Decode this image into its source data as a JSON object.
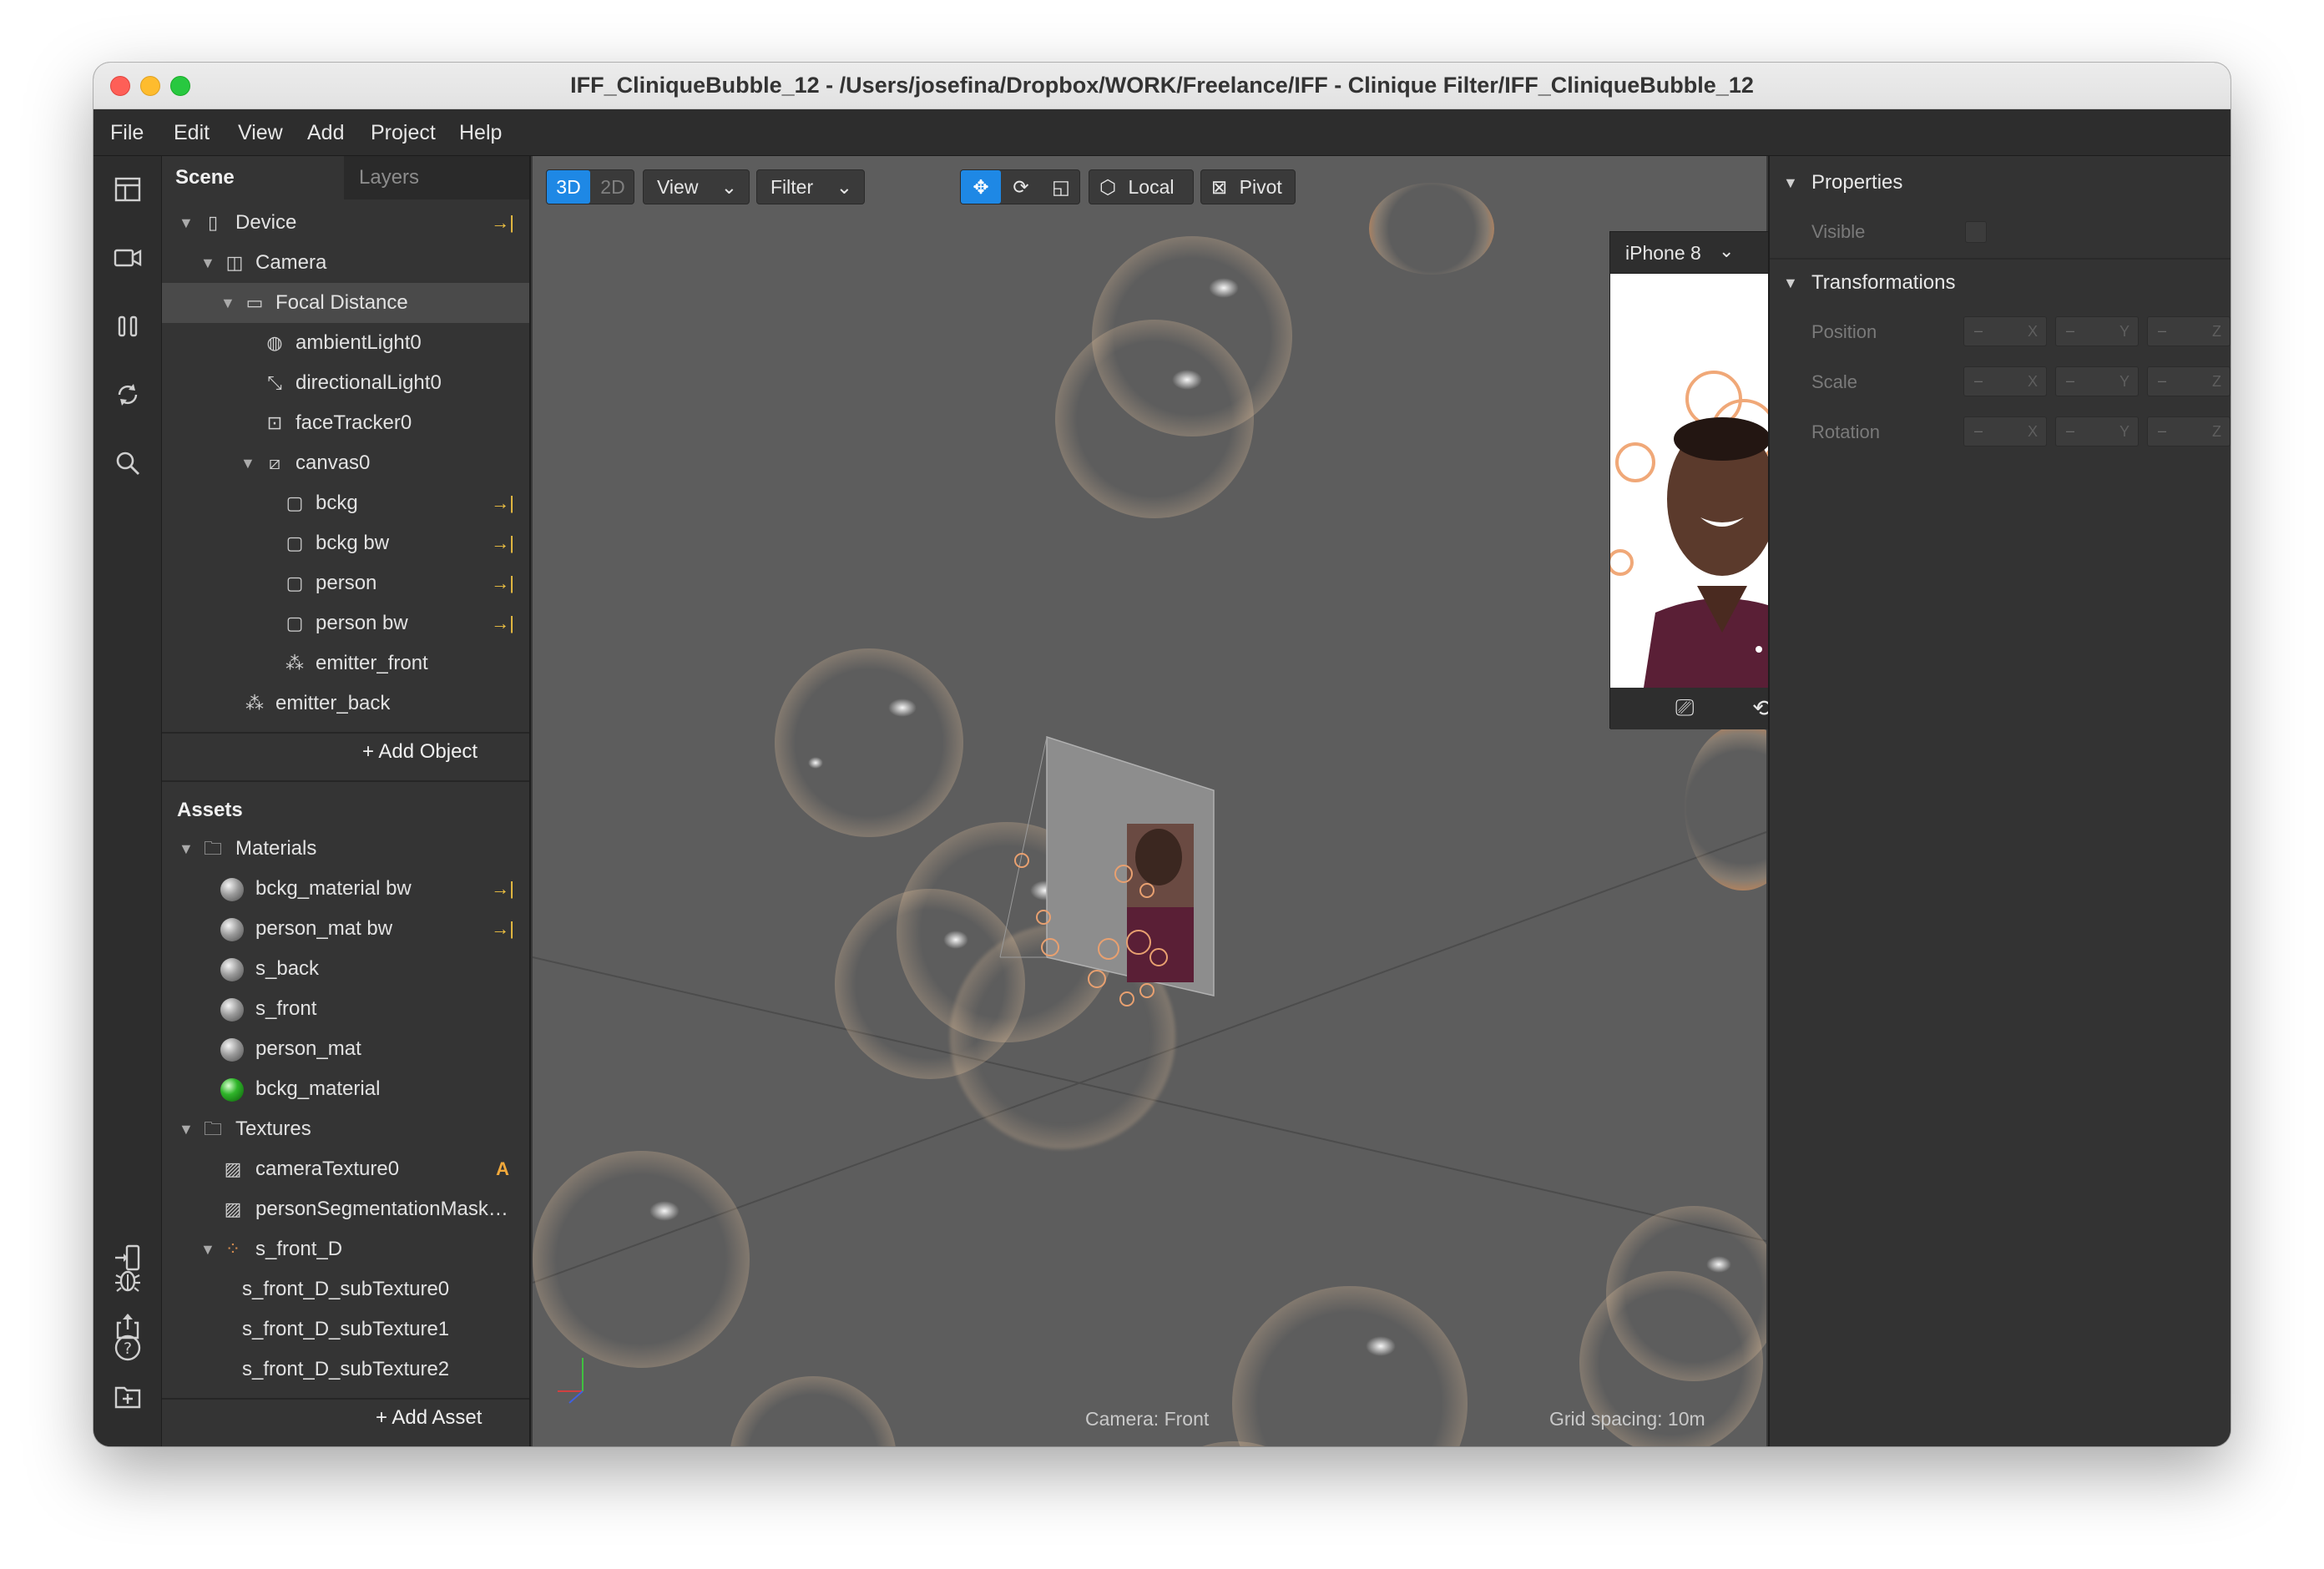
{
  "window": {
    "title": "IFF_CliniqueBubble_12 - /Users/josefina/Dropbox/WORK/Freelance/IFF - Clinique Filter/IFF_CliniqueBubble_12"
  },
  "menu": [
    "File",
    "Edit",
    "View",
    "Add",
    "Project",
    "Help"
  ],
  "scene_panel": {
    "tabs": [
      "Scene",
      "Layers"
    ],
    "tree": [
      {
        "label": "Device",
        "pin": "→|"
      },
      {
        "label": "Camera"
      },
      {
        "label": "Focal Distance"
      },
      {
        "label": "ambientLight0"
      },
      {
        "label": "directionalLight0"
      },
      {
        "label": "faceTracker0"
      },
      {
        "label": "canvas0"
      },
      {
        "label": "bckg",
        "pin": "→|"
      },
      {
        "label": "bckg bw",
        "pin": "→|"
      },
      {
        "label": "person",
        "pin": "→|"
      },
      {
        "label": "person bw",
        "pin": "→|"
      },
      {
        "label": "emitter_front"
      },
      {
        "label": "emitter_back"
      }
    ],
    "add_object": "Add Object"
  },
  "assets_panel": {
    "title": "Assets",
    "materials_folder": "Materials",
    "materials": [
      {
        "label": "bckg_material bw",
        "pin": "→|"
      },
      {
        "label": "person_mat bw",
        "pin": "→|"
      },
      {
        "label": "s_back"
      },
      {
        "label": "s_front"
      },
      {
        "label": "person_mat"
      },
      {
        "label": "bckg_material"
      }
    ],
    "textures_folder": "Textures",
    "textures": [
      {
        "label": "cameraTexture0",
        "badge": "A"
      },
      {
        "label": "personSegmentationMask…"
      },
      {
        "label": "s_front_D"
      },
      {
        "label": "s_front_D_subTexture0"
      },
      {
        "label": "s_front_D_subTexture1"
      },
      {
        "label": "s_front_D_subTexture2"
      }
    ],
    "add_asset": "Add Asset"
  },
  "viewport_toolbar": {
    "mode_3d": "3D",
    "mode_2d": "2D",
    "view": "View",
    "filter": "Filter",
    "local": "Local",
    "pivot": "Pivot"
  },
  "viewport": {
    "camera_label": "Camera: Front",
    "grid_spacing": "Grid spacing: 10m"
  },
  "simulator": {
    "device": "iPhone 8"
  },
  "inspector": {
    "properties_title": "Properties",
    "visible_label": "Visible",
    "transformations_title": "Transformations",
    "rows": [
      {
        "label": "Position",
        "values": [
          "–",
          "–",
          "–"
        ]
      },
      {
        "label": "Scale",
        "values": [
          "–",
          "–",
          "–"
        ]
      },
      {
        "label": "Rotation",
        "values": [
          "–",
          "–",
          "–"
        ]
      }
    ],
    "axes": [
      "X",
      "Y",
      "Z"
    ]
  },
  "colors": {
    "accent": "#1e88e5",
    "pin": "#f4c542",
    "viewport_bg": "#5d5d5d"
  }
}
